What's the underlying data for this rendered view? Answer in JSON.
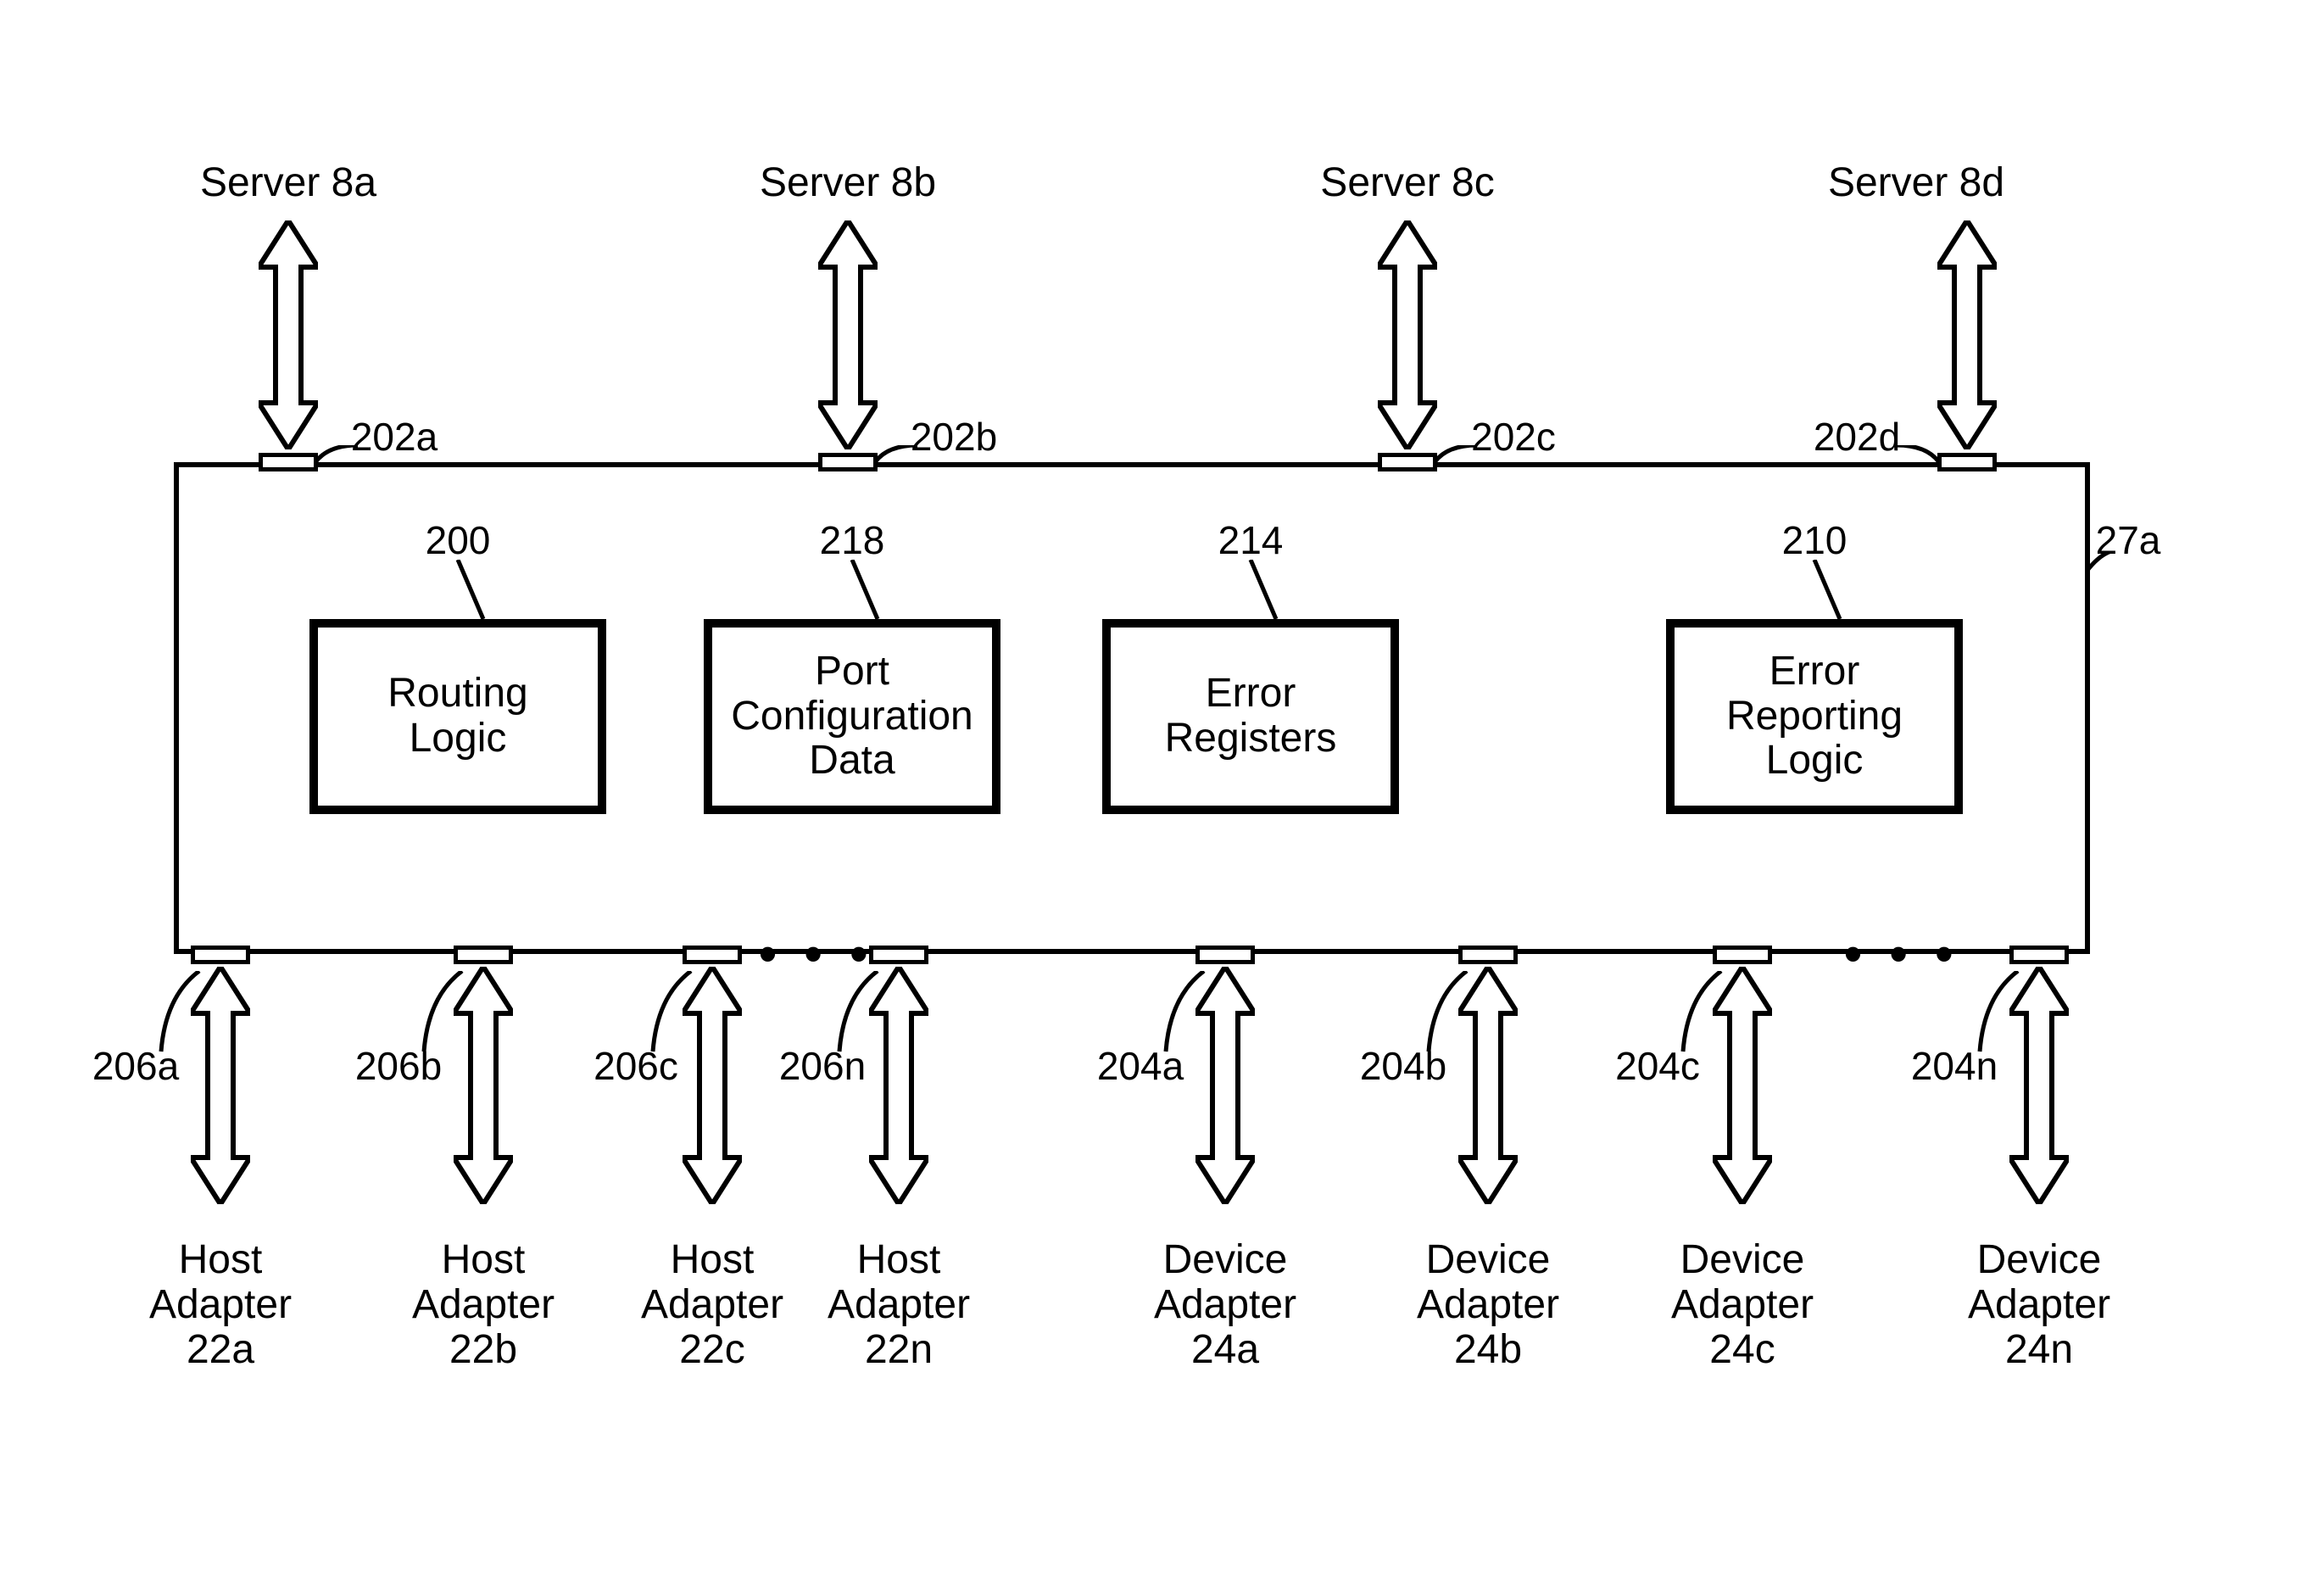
{
  "servers": {
    "a": "Server 8a",
    "b": "Server 8b",
    "c": "Server 8c",
    "d": "Server 8d"
  },
  "top_ports": {
    "a": "202a",
    "b": "202b",
    "c": "202c",
    "d": "202d"
  },
  "main_ref": "27a",
  "inner_refs": {
    "routing": "200",
    "portcfg": "218",
    "errreg": "214",
    "errrep": "210"
  },
  "inner_boxes": {
    "routing": "Routing\nLogic",
    "portcfg": "Port\nConfiguration\nData",
    "errreg": "Error\nRegisters",
    "errrep": "Error\nReporting\nLogic"
  },
  "bottom_left_ports": {
    "a": "206a",
    "b": "206b",
    "c": "206c",
    "n": "206n"
  },
  "bottom_right_ports": {
    "a": "204a",
    "b": "204b",
    "c": "204c",
    "n": "204n"
  },
  "host_adapters": {
    "a": "Host\nAdapter\n22a",
    "b": "Host\nAdapter\n22b",
    "c": "Host\nAdapter\n22c",
    "n": "Host\nAdapter\n22n"
  },
  "device_adapters": {
    "a": "Device\nAdapter\n24a",
    "b": "Device\nAdapter\n24b",
    "c": "Device\nAdapter\n24c",
    "n": "Device\nAdapter\n24n"
  },
  "ellipsis": "• • •"
}
